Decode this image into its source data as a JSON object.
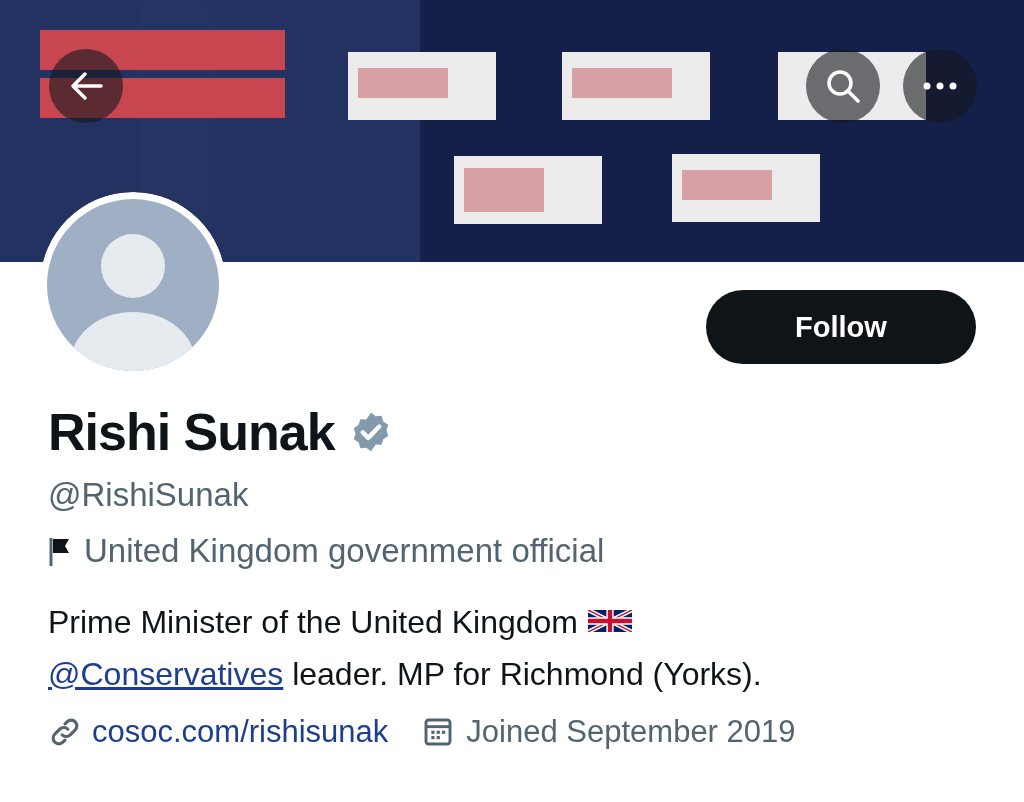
{
  "follow_button": {
    "label": "Follow"
  },
  "profile": {
    "name": "Rishi Sunak",
    "verified": true,
    "handle": "@RishiSunak",
    "category": "United Kingdom government official",
    "bio": [
      {
        "kind": "text",
        "text": "Prime Minister of the United Kingdom"
      },
      {
        "kind": "flag"
      },
      {
        "kind": "break"
      },
      {
        "kind": "link",
        "text": "@Conservatives"
      },
      {
        "kind": "text",
        "text": " leader. MP for Richmond (Yorks)."
      }
    ],
    "website": "cosoc.com/rishisunak",
    "joined": "Joined September 2019"
  }
}
